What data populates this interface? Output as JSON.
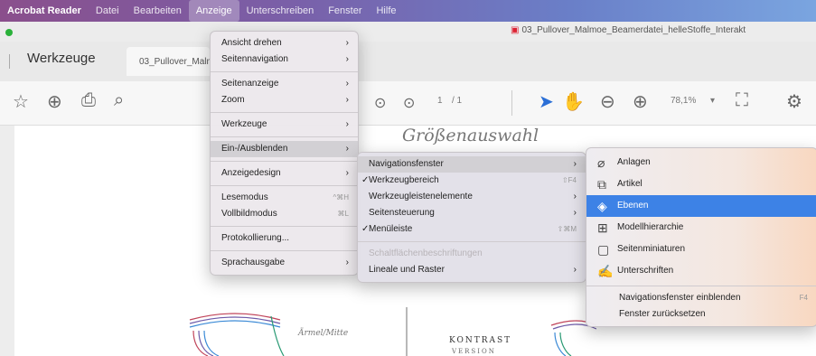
{
  "menubar": {
    "items": [
      {
        "label": "Acrobat Reader"
      },
      {
        "label": "Datei"
      },
      {
        "label": "Bearbeiten"
      },
      {
        "label": "Anzeige"
      },
      {
        "label": "Unterschreiben"
      },
      {
        "label": "Fenster"
      },
      {
        "label": "Hilfe"
      }
    ]
  },
  "window": {
    "doc_title": "03_Pullover_Malmoe_Beamerdatei_helleStoffe_Interakt",
    "tabs": {
      "tools": "Werkzeuge",
      "document": "03_Pullover_Malmoe"
    }
  },
  "toolbar": {
    "page_current": "1",
    "page_total": "/ 1",
    "zoom": "78,1%"
  },
  "document": {
    "handwritten_title": "Größenauswahl",
    "small_note": "Ärmel/Mitte",
    "kontrast": "KONTRAST",
    "kontrast_sub": "VERSION"
  },
  "menu_anzeige": {
    "items": [
      {
        "label": "Ansicht drehen"
      },
      {
        "label": "Seitennavigation"
      },
      {
        "label": "Seitenanzeige"
      },
      {
        "label": "Zoom"
      },
      {
        "label": "Werkzeuge"
      },
      {
        "label": "Ein-/Ausblenden"
      },
      {
        "label": "Anzeigedesign"
      },
      {
        "label": "Lesemodus",
        "shortcut": "^⌘H"
      },
      {
        "label": "Vollbildmodus",
        "shortcut": "⌘L"
      },
      {
        "label": "Protokollierung..."
      },
      {
        "label": "Sprachausgabe"
      }
    ]
  },
  "menu_einausblenden": {
    "items": [
      {
        "label": "Navigationsfenster"
      },
      {
        "label": "Werkzeugbereich",
        "shortcut": "⇧F4"
      },
      {
        "label": "Werkzeugleistenelemente"
      },
      {
        "label": "Seitensteuerung"
      },
      {
        "label": "Menüleiste",
        "shortcut": "⇧⌘M"
      },
      {
        "label": "Schaltflächenbeschriftungen"
      },
      {
        "label": "Lineale und Raster"
      }
    ]
  },
  "menu_navigationsfenster": {
    "items": [
      {
        "label": "Anlagen",
        "icon": "paperclip-icon"
      },
      {
        "label": "Artikel",
        "icon": "article-icon"
      },
      {
        "label": "Ebenen",
        "icon": "layers-icon"
      },
      {
        "label": "Modellhierarchie",
        "icon": "model-tree-icon"
      },
      {
        "label": "Seitenminiaturen",
        "icon": "page-thumbnails-icon"
      },
      {
        "label": "Unterschriften",
        "icon": "signature-icon"
      },
      {
        "label": "Navigationsfenster einblenden",
        "shortcut": "F4"
      },
      {
        "label": "Fenster zurücksetzen"
      }
    ]
  },
  "colors": {
    "highlight": "#3d82e6",
    "pdf_icon": "#d22233",
    "window_green": "#2ab13a"
  }
}
